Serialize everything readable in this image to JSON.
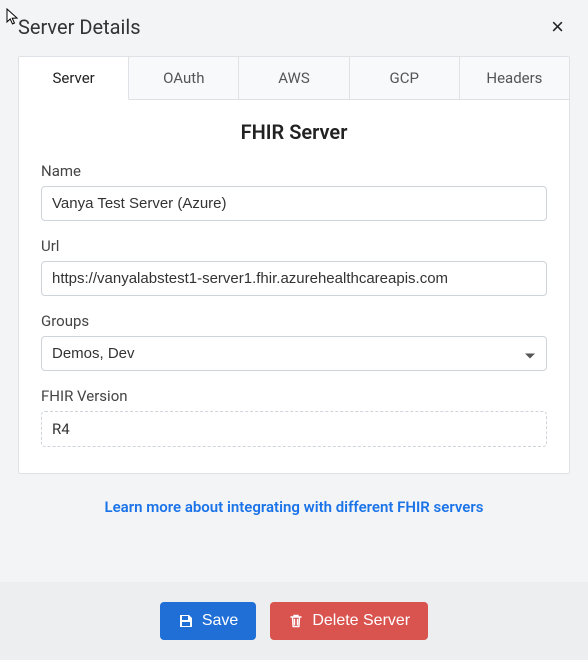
{
  "header": {
    "title": "Server Details",
    "close_label": "×"
  },
  "tabs": [
    {
      "label": "Server",
      "active": true
    },
    {
      "label": "OAuth"
    },
    {
      "label": "AWS"
    },
    {
      "label": "GCP"
    },
    {
      "label": "Headers"
    }
  ],
  "form": {
    "section_title": "FHIR Server",
    "name_label": "Name",
    "name_value": "Vanya Test Server (Azure)",
    "url_label": "Url",
    "url_value": "https://vanyalabstest1-server1.fhir.azurehealthcareapis.com",
    "groups_label": "Groups",
    "groups_value": "Demos, Dev",
    "version_label": "FHIR Version",
    "version_value": "R4"
  },
  "link": {
    "learn_more": "Learn more about integrating with different FHIR servers"
  },
  "footer": {
    "save_label": "Save",
    "delete_label": "Delete Server"
  }
}
